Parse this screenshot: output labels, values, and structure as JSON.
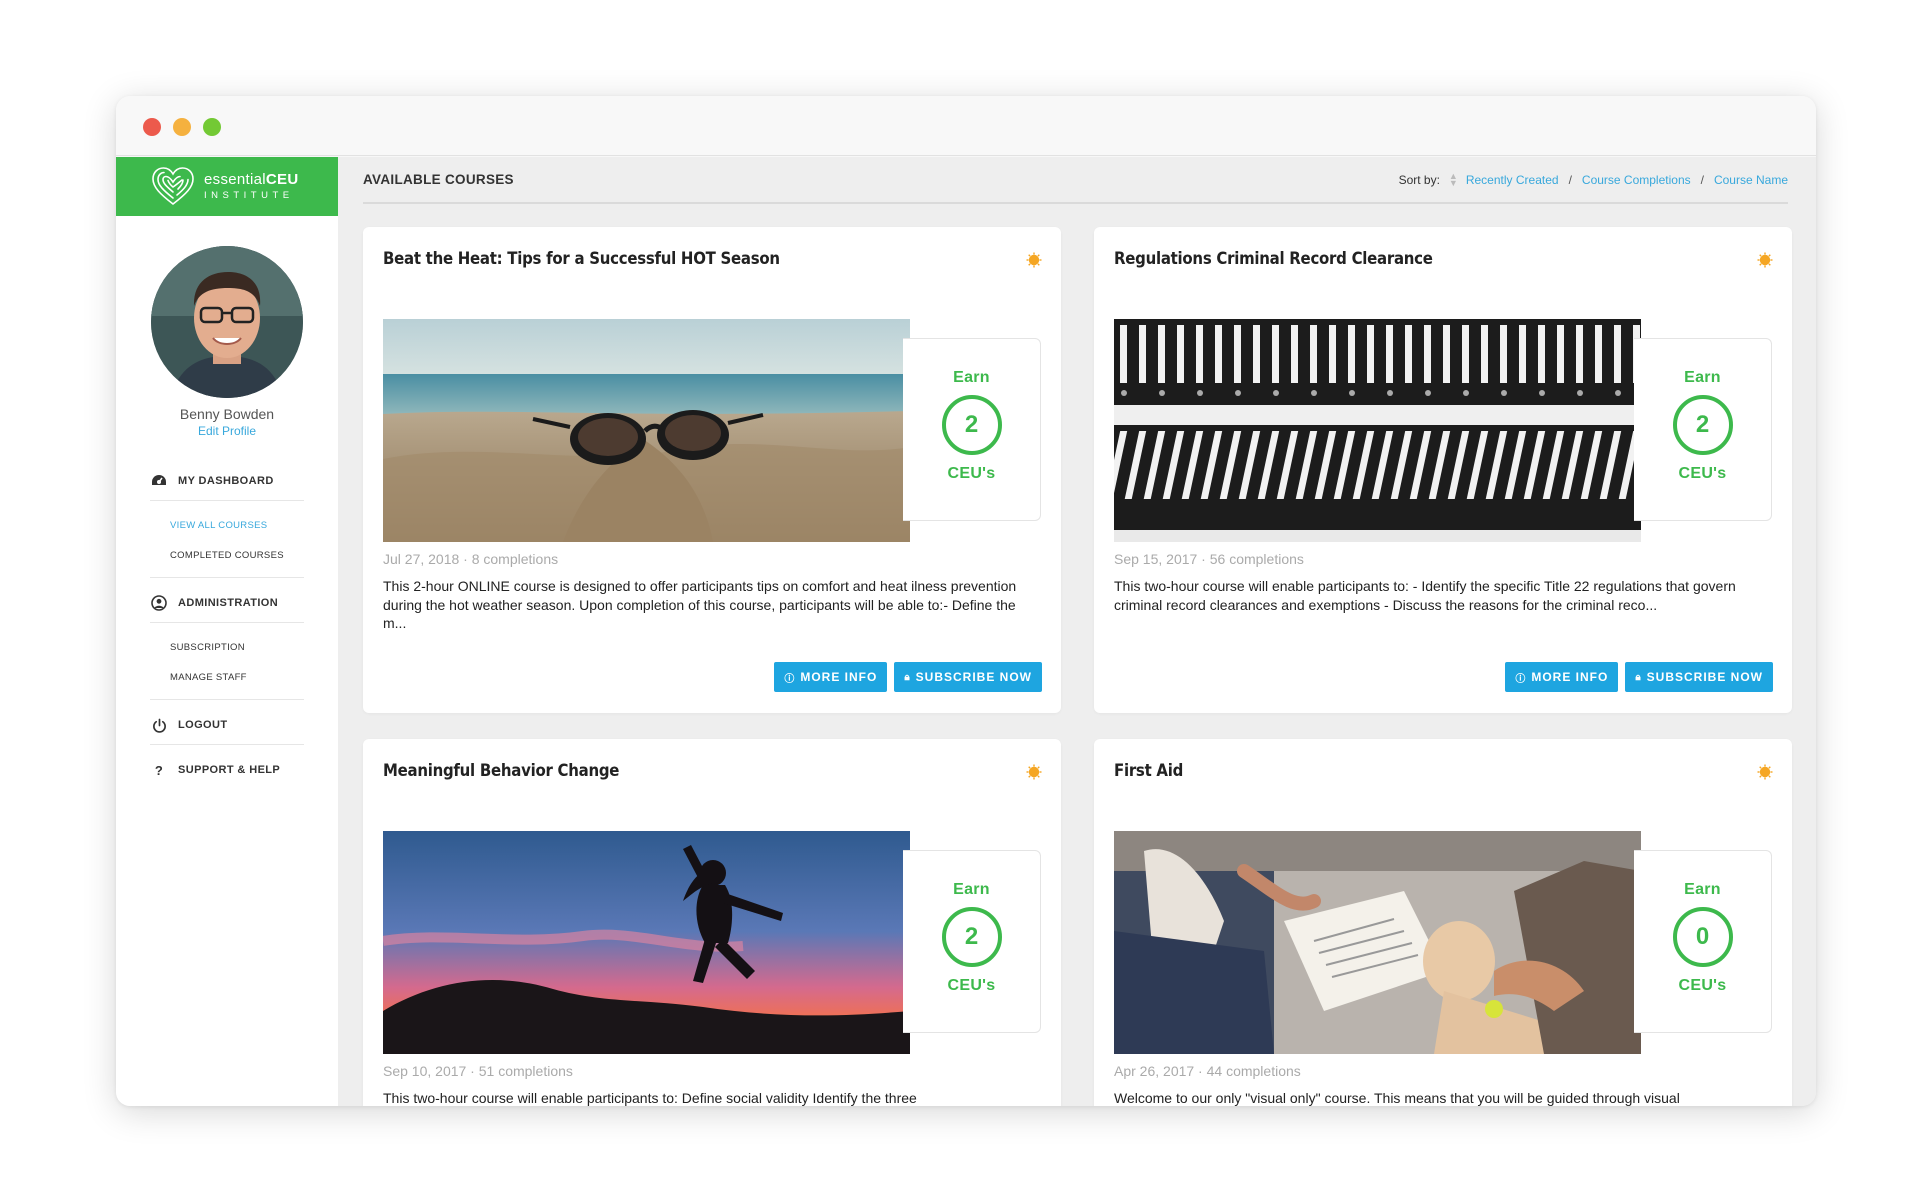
{
  "brand": {
    "name_light": "essential",
    "name_bold": "CEU",
    "sub": "INSTITUTE",
    "color": "#3db94c"
  },
  "profile": {
    "name": "Benny Bowden",
    "edit_label": "Edit Profile"
  },
  "nav": {
    "dashboard": "MY DASHBOARD",
    "view_all": "VIEW ALL COURSES",
    "completed": "COMPLETED COURSES",
    "administration": "ADMINISTRATION",
    "subscription": "SUBSCRIPTION",
    "manage_staff": "MANAGE STAFF",
    "logout": "LOGOUT",
    "support": "SUPPORT & HELP"
  },
  "header": {
    "title": "AVAILABLE COURSES",
    "sort_label": "Sort by:",
    "sort_options": [
      "Recently Created",
      "Course Completions",
      "Course Name"
    ],
    "sort_sep": "/"
  },
  "earn": {
    "label": "Earn",
    "unit": "CEU's"
  },
  "buttons": {
    "more_info": "MORE INFO",
    "subscribe": "SUBSCRIBE NOW"
  },
  "courses": [
    {
      "title": "Beat the Heat: Tips for a Successful HOT Season",
      "ceu": "2",
      "meta": "Jul 27, 2018 · 8 completions",
      "description": "This 2-hour ONLINE course is designed to offer participants tips on comfort and heat ilness prevention during the hot weather season. Upon completion of this course, participants will be able to:- Define the m...",
      "image": "sunglasses-on-beach"
    },
    {
      "title": "Regulations Criminal Record Clearance",
      "ceu": "2",
      "meta": "Sep 15, 2017 · 56 completions",
      "description": "This two-hour course will enable participants to: - Identify the specific Title 22 regulations that govern criminal record clearances and exemptions - Discuss the reasons for the criminal reco...",
      "image": "binders-on-shelves"
    },
    {
      "title": "Meaningful Behavior Change",
      "ceu": "2",
      "meta": "Sep 10, 2017 · 51 completions",
      "description": "This two-hour course will enable participants to: Define social validity Identify the three",
      "image": "person-jumping-at-sunset"
    },
    {
      "title": "First Aid",
      "ceu": "0",
      "meta": "Apr 26, 2017 · 44 completions",
      "description": "Welcome to our only \"visual only\" course. This means that you will be guided through visual",
      "image": "first-aid-cpr-training"
    }
  ],
  "colors": {
    "accent": "#1ea5e0",
    "link": "#38a8dc",
    "badge": "#f5a623"
  }
}
